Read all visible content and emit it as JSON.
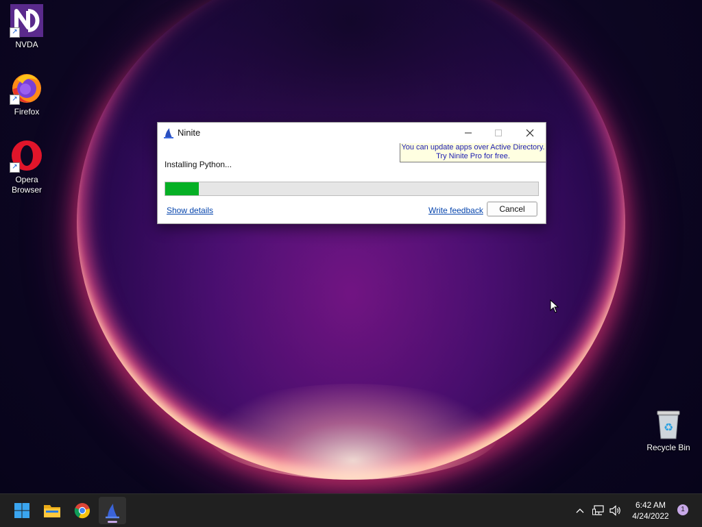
{
  "desktop": {
    "icons": [
      {
        "label": "NVDA"
      },
      {
        "label": "Firefox"
      },
      {
        "label": "Opera Browser"
      },
      {
        "label": "Recycle Bin"
      }
    ]
  },
  "dialog": {
    "title": "Ninite",
    "promo_line1": "You can update apps over Active Directory.",
    "promo_line2": "Try Ninite Pro for free.",
    "status": "Installing Python...",
    "progress_fraction": 0.09,
    "show_details_label": "Show details",
    "write_feedback_label": "Write feedback",
    "cancel_label": "Cancel",
    "progress_color": "#06b025"
  },
  "taskbar": {
    "apps": [
      "start-icon",
      "file-explorer-icon",
      "chrome-icon",
      "ninite-icon"
    ],
    "time": "6:42 AM",
    "date": "4/24/2022",
    "notification_count": "1"
  }
}
